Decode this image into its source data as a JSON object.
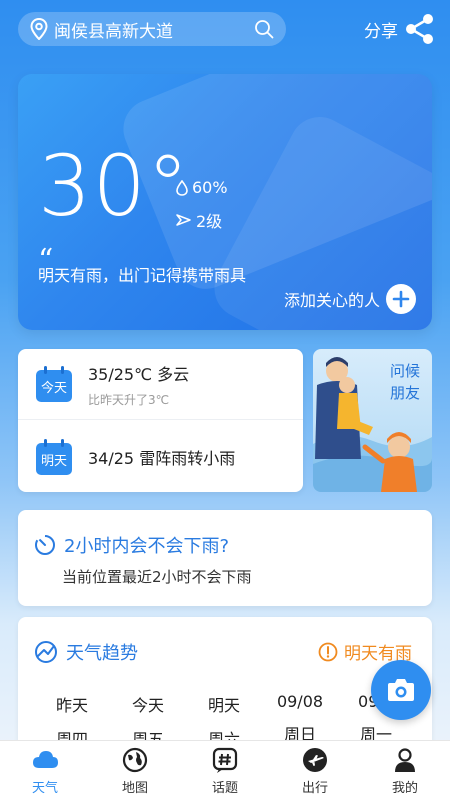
{
  "header": {
    "location": "闽侯县高新大道",
    "share_label": "分享"
  },
  "weather": {
    "temperature": "30°",
    "humidity": "60%",
    "wind_level": "2级",
    "tip": "明天有雨，出门记得携带雨具",
    "add_care_label": "添加关心的人"
  },
  "forecast": {
    "today": {
      "tag": "今天",
      "main": "35/25℃ 多云",
      "sub": "比昨天升了3℃"
    },
    "tomorrow": {
      "tag": "明天",
      "main": "34/25 雷阵雨转小雨"
    }
  },
  "greeting_card": {
    "line1": "问候",
    "line2": "朋友"
  },
  "rain": {
    "title": "2小时内会不会下雨?",
    "subtitle": "当前位置最近2小时不会下雨"
  },
  "trend": {
    "title": "天气趋势",
    "alert": "明天有雨",
    "days": [
      {
        "d1": "昨天",
        "d2": "周四"
      },
      {
        "d1": "今天",
        "d2": "周五"
      },
      {
        "d1": "明天",
        "d2": "周六"
      },
      {
        "d1": "09/08",
        "d2": "周日"
      },
      {
        "d1": "09/0",
        "d2": "周一"
      }
    ]
  },
  "nav": {
    "items": [
      {
        "label": "天气",
        "icon": "cloud-icon",
        "active": true
      },
      {
        "label": "地图",
        "icon": "globe-icon"
      },
      {
        "label": "话题",
        "icon": "hashtag-icon"
      },
      {
        "label": "出行",
        "icon": "plane-icon"
      },
      {
        "label": "我的",
        "icon": "person-icon"
      }
    ]
  },
  "colors": {
    "accent": "#2f8ef0",
    "alert": "#f08a1f"
  }
}
